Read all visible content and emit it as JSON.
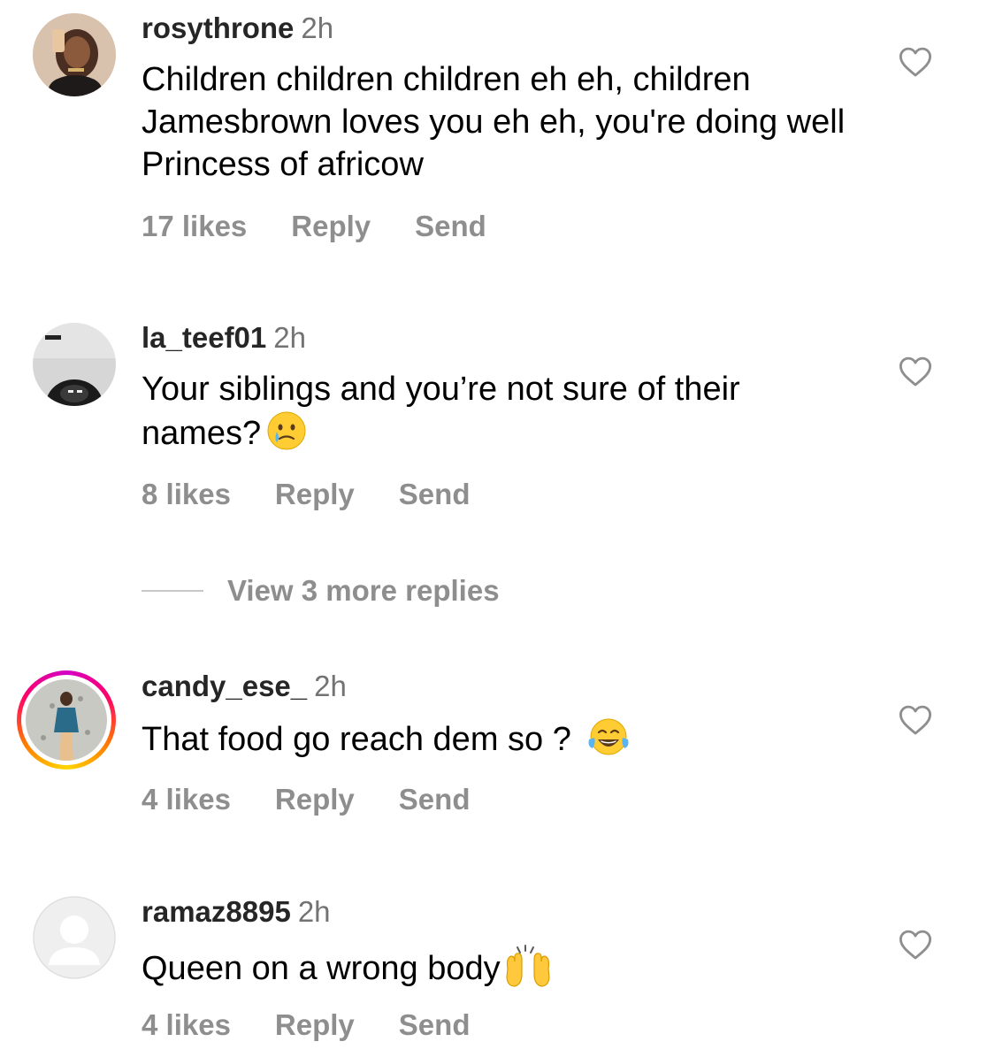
{
  "comments": [
    {
      "username": "rosythrone",
      "time": "2h",
      "text": "Children children children eh eh, children Jamesbrown loves you eh eh, you're doing well Princess of africow",
      "likes": "17 likes",
      "reply": "Reply",
      "send": "Send",
      "avatar": "profile-photo"
    },
    {
      "username": "la_teef01",
      "time": "2h",
      "text": "Your siblings and you’re not sure of their names?",
      "emoji": "crying-face-emoji",
      "likes": "8 likes",
      "reply": "Reply",
      "send": "Send",
      "avatar": "profile-photo"
    },
    {
      "username": "candy_ese_",
      "time": "2h",
      "text": "That food go reach dem so ? ",
      "emoji": "tears-of-joy-emoji",
      "likes": "4 likes",
      "reply": "Reply",
      "send": "Send",
      "avatar": "profile-photo-with-story-ring"
    },
    {
      "username": "ramaz8895",
      "time": "2h",
      "text": "Queen on a wrong body",
      "emoji": "raising-hands-emoji",
      "likes": "4 likes",
      "reply": "Reply",
      "send": "Send",
      "avatar": "default-avatar"
    }
  ],
  "view_replies": "View 3 more replies",
  "icons": {
    "like": "heart-outline-icon"
  },
  "colors": {
    "username": "#262626",
    "secondary_text": "#8e8e8e",
    "timestamp": "#737373",
    "story_ring": [
      "#d300c5",
      "#ff0069",
      "#ff7a00",
      "#ffd600"
    ]
  }
}
